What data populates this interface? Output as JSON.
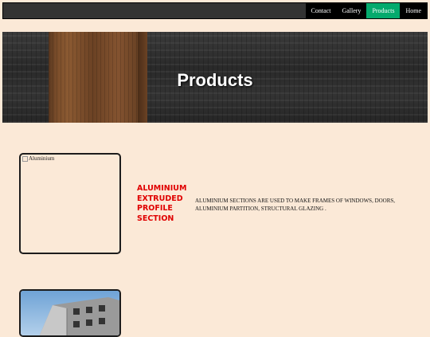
{
  "nav": {
    "links": [
      {
        "label": "Contact"
      },
      {
        "label": "Gallery"
      },
      {
        "label": "Products"
      },
      {
        "label": "Home"
      }
    ],
    "active_index": 2,
    "active_color": "#04aa6d"
  },
  "hero": {
    "title": "Products"
  },
  "products": [
    {
      "image_alt": "Aluminium",
      "heading": "ALUMINIUM EXTRUDED PROFILE SECTION",
      "description": "ALUMINIUM SECTIONS ARE USED TO MAKE FRAMES OF WINDOWS, DOORS, ALUMINIUM PARTITION, STRUCTURAL GLAZING ."
    },
    {
      "image_alt": ""
    }
  ],
  "colors": {
    "page_background": "#fbe9d7",
    "navbar_background": "#333333",
    "heading_red": "#e00000"
  }
}
